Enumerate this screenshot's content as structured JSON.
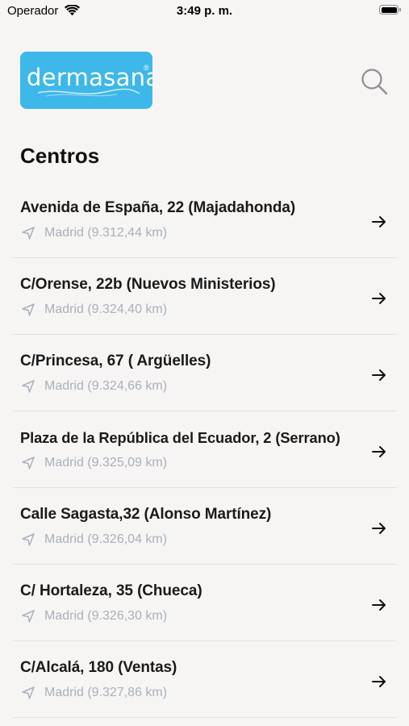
{
  "status_bar": {
    "carrier": "Operador",
    "time": "3:49 p. m."
  },
  "header": {
    "logo_text": "dermasana",
    "logo_mark": "®",
    "brand_color": "#3db8e8"
  },
  "page": {
    "title": "Centros"
  },
  "centers": [
    {
      "name": "Avenida de España, 22 (Majadahonda)",
      "city": "Madrid (9.312,44 km)"
    },
    {
      "name": "C/Orense, 22b (Nuevos Ministerios)",
      "city": "Madrid (9.324,40 km)"
    },
    {
      "name": "C/Princesa, 67 ( Argüelles)",
      "city": "Madrid (9.324,66 km)"
    },
    {
      "name": "Plaza de la República del Ecuador, 2 (Serrano)",
      "city": "Madrid (9.325,09 km)"
    },
    {
      "name": "Calle Sagasta,32 (Alonso Martínez)",
      "city": "Madrid (9.326,04 km)"
    },
    {
      "name": "C/ Hortaleza, 35 (Chueca)",
      "city": "Madrid (9.326,30 km)"
    },
    {
      "name": "C/Alcalá, 180 (Ventas)",
      "city": "Madrid (9.327,86 km)"
    }
  ],
  "icons": {
    "wifi": "wifi-icon",
    "battery": "battery-icon",
    "search": "search-icon",
    "location": "location-arrow-icon",
    "chevron": "arrow-right-icon"
  }
}
